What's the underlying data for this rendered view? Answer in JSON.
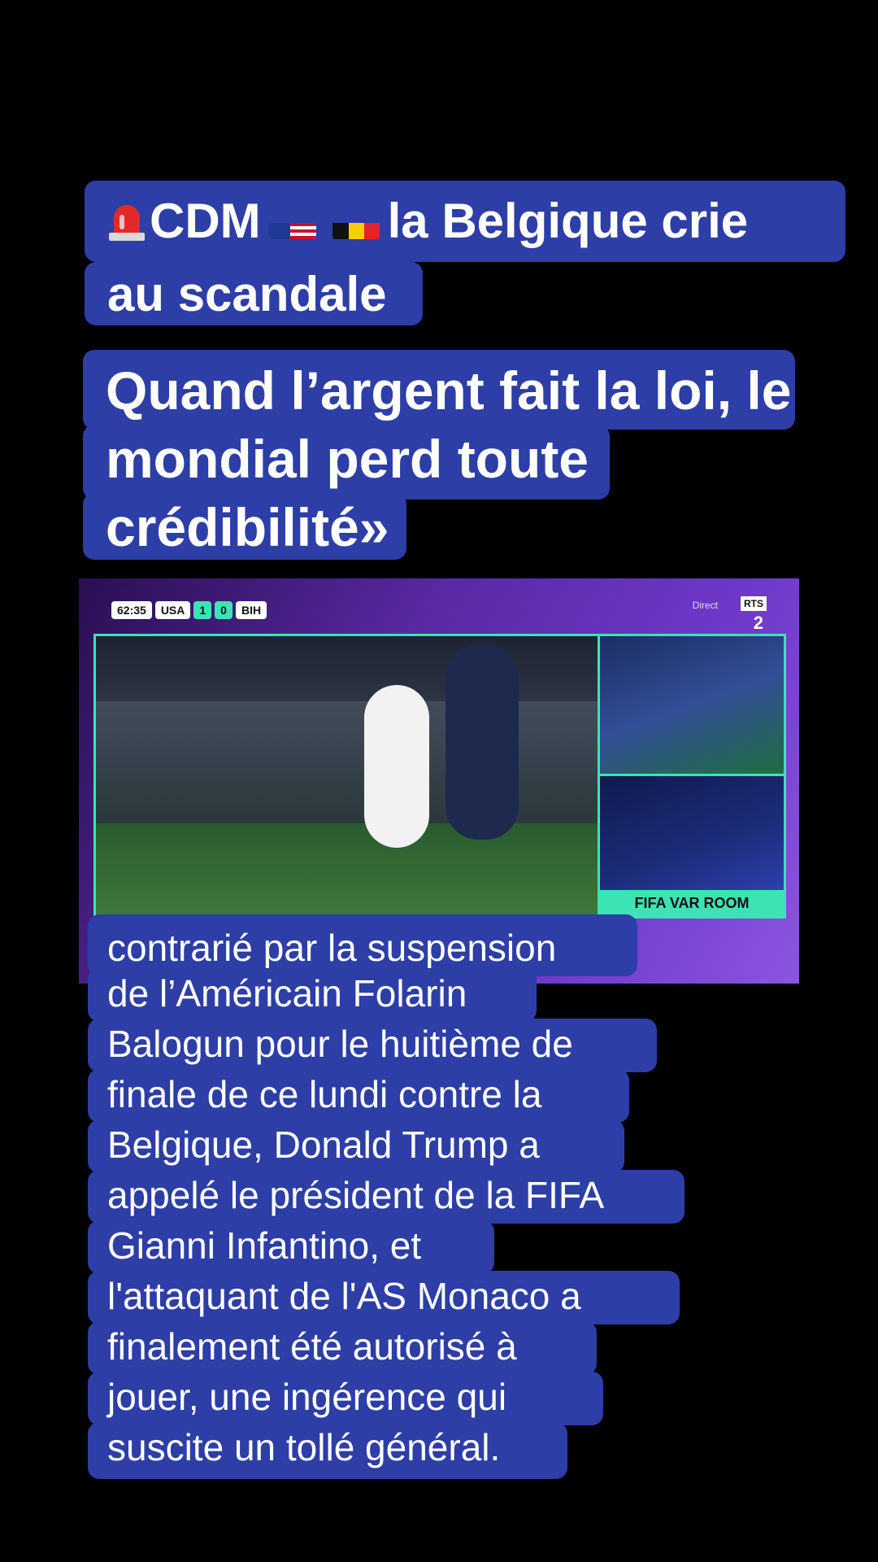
{
  "headline": {
    "line1_text": "CDM",
    "line1_rest": "la Belgique crie",
    "line2": "au scandale"
  },
  "quote": {
    "lines": [
      "Quand l’argent fait la loi, le",
      "mondial perd toute",
      "crédibilité»"
    ]
  },
  "video": {
    "clock": "62:35",
    "team_home": "USA",
    "score_home": "1",
    "score_away": "0",
    "team_away": "BIH",
    "live_label": "Direct",
    "channel": "RTS",
    "channel_num": "2",
    "var_label": "FIFA VAR ROOM"
  },
  "body": {
    "lines": [
      "contrarié par la suspension",
      "de l’Américain Folarin",
      "Balogun pour le huitième de",
      "finale de ce lundi contre la",
      "Belgique, Donald Trump a",
      "appelé le président de la FIFA",
      "Gianni Infantino, et",
      "l'attaquant de l'AS Monaco a",
      "finalement été autorisé à",
      "jouer, une ingérence qui",
      "suscite un tollé général."
    ]
  },
  "colors": {
    "caption_bg": "#2d3ea6",
    "accent": "#3de3b5"
  },
  "icons": [
    "siren-icon",
    "us-flag-icon",
    "belgium-flag-icon"
  ]
}
